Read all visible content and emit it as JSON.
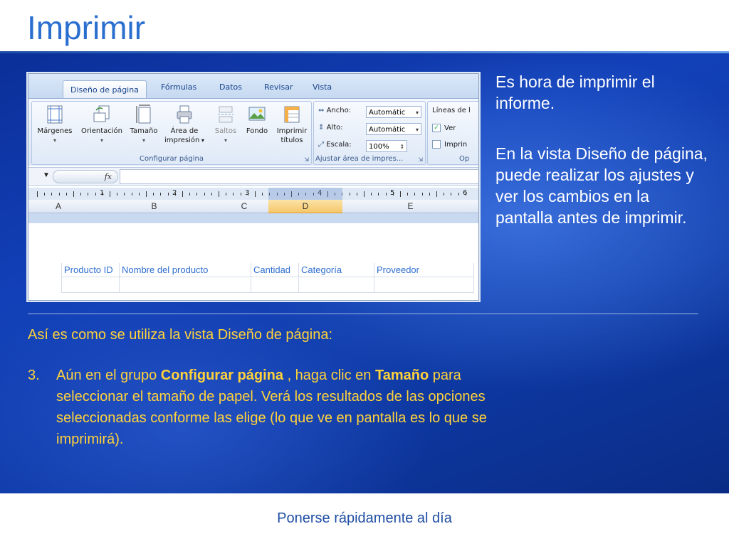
{
  "slide": {
    "title": "Imprimir",
    "footer": "Ponerse rápidamente al día",
    "panel_p1": "Es hora de imprimir el informe.",
    "panel_p2": "En la vista Diseño de página, puede realizar los ajustes y ver los cambios en la pantalla antes de imprimir.",
    "subheading": "Así es como se utiliza la vista Diseño de página:",
    "step": {
      "number": "3.",
      "text_a": "Aún en el grupo ",
      "bold_a": "Configurar página",
      "text_b": " , haga clic en ",
      "bold_b": "Tamaño",
      "text_c": " para seleccionar el tamaño de papel. Verá los resultados de las opciones seleccionadas conforme las elige (lo que ve en pantalla es lo que se imprimirá)."
    }
  },
  "ribbon": {
    "tabs": [
      "Diseño de página",
      "Fórmulas",
      "Datos",
      "Revisar",
      "Vista"
    ],
    "active_tab": "Diseño de página",
    "page_setup": {
      "label": "Configurar página",
      "buttons": {
        "margins": "Márgenes",
        "orientation": "Orientación",
        "size": "Tamaño",
        "print_area_1": "Área de",
        "print_area_2": "impresión",
        "breaks": "Saltos",
        "background": "Fondo",
        "print_titles_1": "Imprimir",
        "print_titles_2": "títulos"
      }
    },
    "scale_to_fit": {
      "label": "Ajustar área de impres...",
      "width_label": "Ancho:",
      "width_value": "Automátic",
      "height_label": "Alto:",
      "height_value": "Automátic",
      "scale_label": "Escala:",
      "scale_value": "100%"
    },
    "sheet_options": {
      "label": "Líneas de l",
      "view": "Ver",
      "print": "Imprin",
      "footer": "Op"
    }
  },
  "formula_bar": {
    "fx": "fx"
  },
  "ruler": {
    "numbers": [
      "1",
      "2",
      "3",
      "4",
      "5",
      "6"
    ]
  },
  "columns": [
    "A",
    "B",
    "C",
    "D",
    "E"
  ],
  "selected_column": "D",
  "table_headers": [
    "Producto ID",
    "Nombre del producto",
    "Cantidad",
    "Categoría",
    "Proveedor"
  ],
  "colors": {
    "slide_blue": "#1240b8",
    "title_blue": "#2a6fcf",
    "accent_yellow": "#ffd23a",
    "header_text_blue": "#2f6fcf"
  }
}
